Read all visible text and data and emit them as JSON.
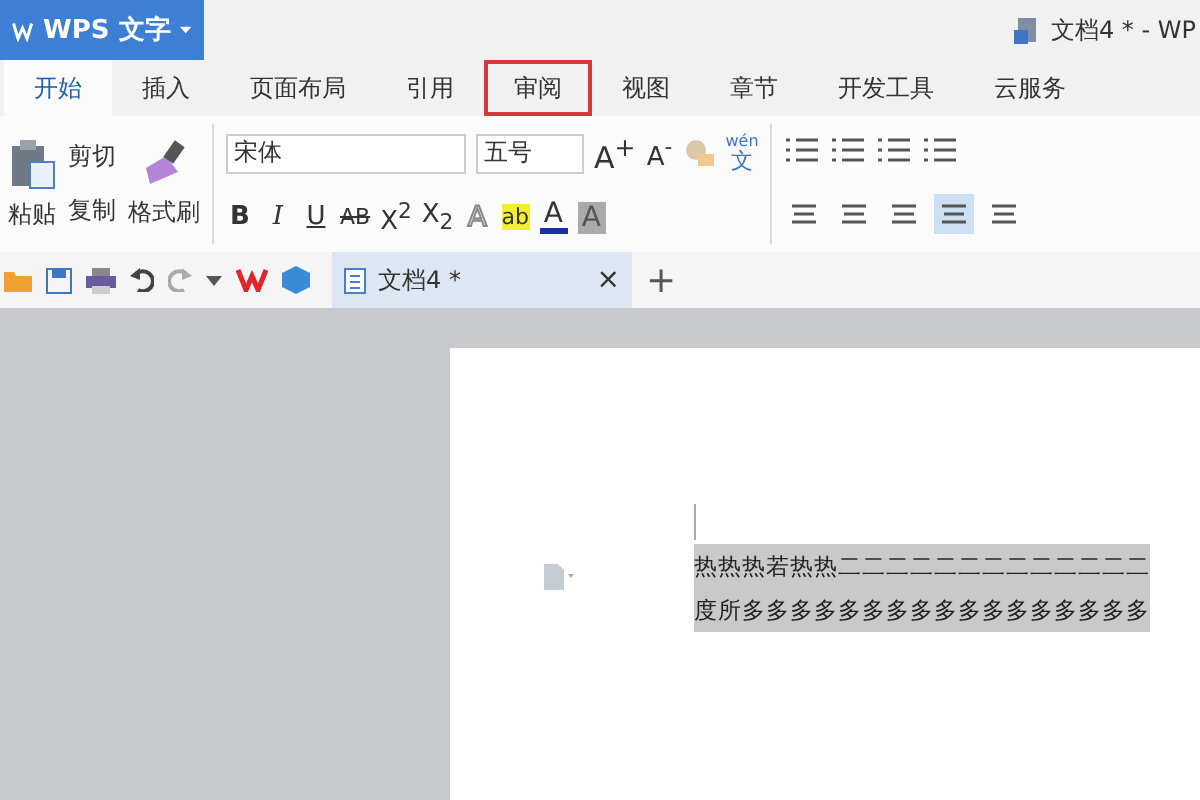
{
  "app_button": {
    "label": "WPS 文字"
  },
  "window_title": "文档4 * - WP",
  "tabs": [
    {
      "label": "开始",
      "selected": true,
      "highlighted": false
    },
    {
      "label": "插入",
      "selected": false,
      "highlighted": false
    },
    {
      "label": "页面布局",
      "selected": false,
      "highlighted": false
    },
    {
      "label": "引用",
      "selected": false,
      "highlighted": false
    },
    {
      "label": "审阅",
      "selected": false,
      "highlighted": true
    },
    {
      "label": "视图",
      "selected": false,
      "highlighted": false
    },
    {
      "label": "章节",
      "selected": false,
      "highlighted": false
    },
    {
      "label": "开发工具",
      "selected": false,
      "highlighted": false
    },
    {
      "label": "云服务",
      "selected": false,
      "highlighted": false
    }
  ],
  "clipboard": {
    "paste": "粘贴",
    "cut": "剪切",
    "copy": "复制",
    "format_painter": "格式刷"
  },
  "font": {
    "name": "宋体",
    "size": "五号",
    "grow": "A$^{+}$",
    "shrink": "A$^{-}$",
    "phonetic_top": "wén",
    "phonetic_bottom": "文"
  },
  "format_buttons": [
    {
      "label": "B",
      "kind": "bold"
    },
    {
      "label": "I",
      "kind": "italic"
    },
    {
      "label": "U",
      "kind": "underline"
    },
    {
      "label": "AB",
      "kind": "strike"
    },
    {
      "label": "X$^{2}$",
      "kind": "plain"
    },
    {
      "label": "X$_{2}$",
      "kind": "plain"
    }
  ],
  "effects": [
    {
      "label": "A",
      "kind": "outline"
    },
    {
      "label": "ab",
      "kind": "highlight"
    },
    {
      "label": "A",
      "kind": "color"
    },
    {
      "label": "A",
      "kind": "shade"
    }
  ],
  "alignment": [
    {
      "selected": false
    },
    {
      "selected": false
    },
    {
      "selected": false
    },
    {
      "selected": true
    },
    {
      "selected": false
    }
  ],
  "document_tab": {
    "label": "文档4 *",
    "close": "×"
  },
  "new_tab": "+",
  "document_lines": [
    "热热热若热热二二二二二二二二二二二二二",
    "度所多多多多多多多多多多多多多多多多多"
  ]
}
